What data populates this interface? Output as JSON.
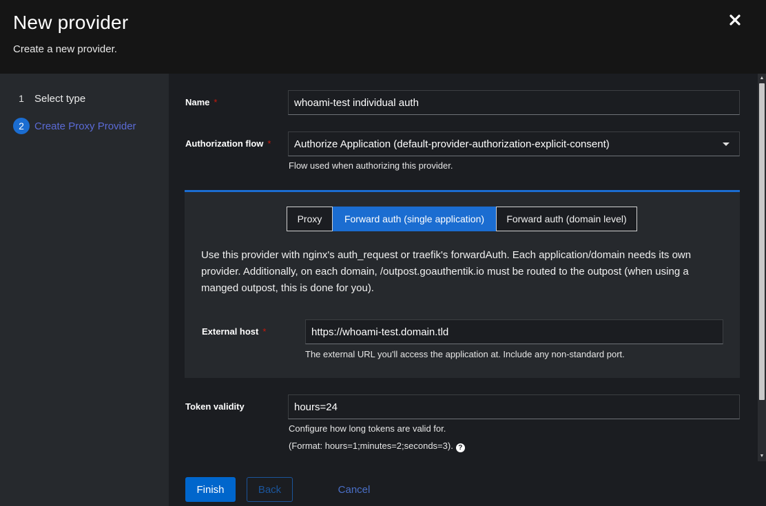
{
  "header": {
    "title": "New provider",
    "subtitle": "Create a new provider.",
    "close_icon": "close-icon"
  },
  "wizard": {
    "steps": [
      {
        "number": "1",
        "label": "Select type"
      },
      {
        "number": "2",
        "label": "Create Proxy Provider"
      }
    ]
  },
  "form": {
    "name": {
      "label": "Name",
      "required_mark": "*",
      "value": "whoami-test individual auth"
    },
    "authorization_flow": {
      "label": "Authorization flow",
      "required_mark": "*",
      "selected": "Authorize Application (default-provider-authorization-explicit-consent)",
      "helper": "Flow used when authorizing this provider."
    },
    "mode_tabs": [
      {
        "label": "Proxy"
      },
      {
        "label": "Forward auth (single application)"
      },
      {
        "label": "Forward auth (domain level)"
      }
    ],
    "mode_description": "Use this provider with nginx's auth_request or traefik's forwardAuth. Each application/domain needs its own provider. Additionally, on each domain, /outpost.goauthentik.io must be routed to the outpost (when using a manged outpost, this is done for you).",
    "external_host": {
      "label": "External host",
      "required_mark": "*",
      "value": "https://whoami-test.domain.tld",
      "helper": "The external URL you'll access the application at. Include any non-standard port."
    },
    "token_validity": {
      "label": "Token validity",
      "value": "hours=24",
      "helper_line1": "Configure how long tokens are valid for.",
      "helper_line2": "(Format: hours=1;minutes=2;seconds=3).",
      "help_icon": "?"
    }
  },
  "footer": {
    "finish_label": "Finish",
    "back_label": "Back",
    "cancel_label": "Cancel"
  },
  "colors": {
    "accent": "#0066cc",
    "active_step": "#5b6bd6",
    "required": "#c9190b"
  }
}
